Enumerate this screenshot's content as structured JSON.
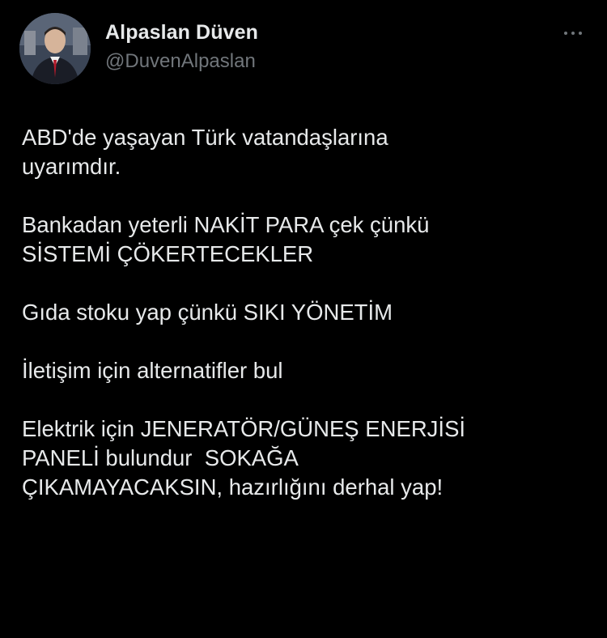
{
  "author": {
    "display_name": "Alpaslan Düven",
    "handle": "@DuvenAlpaslan"
  },
  "more_icon": "more-horizontal-icon",
  "tweet": {
    "paragraphs": [
      [
        "ABD'de yaşayan Türk vatandaşlarına",
        "uyarımdır."
      ],
      [
        "Bankadan yeterli NAKİT PARA çek çünkü",
        "SİSTEMİ ÇÖKERTECEKLER"
      ],
      [
        "Gıda stoku yap çünkü SIKI YÖNETİM"
      ],
      [
        "İletişim için alternatifler bul"
      ],
      [
        "Elektrik için JENERATÖR/GÜNEŞ ENERJİSİ",
        "PANELİ bulundur  SOKAĞA",
        "ÇIKAMAYACAKSIN, hazırlığını derhal yap!"
      ]
    ]
  },
  "colors": {
    "background": "#000000",
    "text_primary": "#e7e9ea",
    "text_secondary": "#71767b"
  }
}
